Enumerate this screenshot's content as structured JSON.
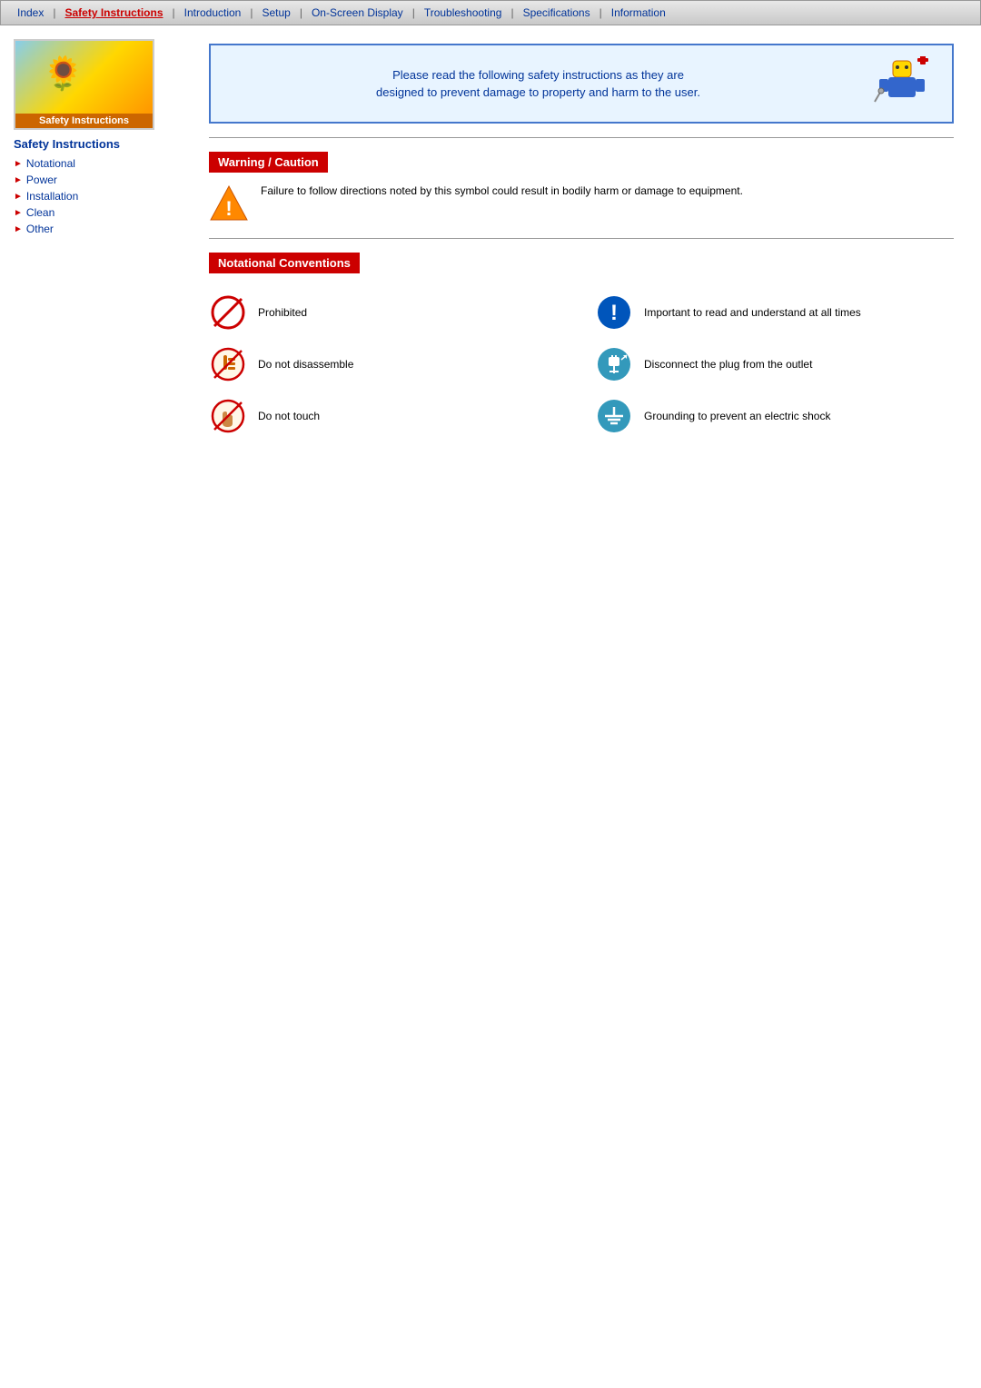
{
  "navbar": {
    "items": [
      {
        "label": "Index",
        "active": false
      },
      {
        "label": "Safety Instructions",
        "active": true
      },
      {
        "label": "Introduction",
        "active": false
      },
      {
        "label": "Setup",
        "active": false
      },
      {
        "label": "On-Screen Display",
        "active": false
      },
      {
        "label": "Troubleshooting",
        "active": false
      },
      {
        "label": "Specifications",
        "active": false
      },
      {
        "label": "Information",
        "active": false
      }
    ]
  },
  "sidebar": {
    "logo_label": "Safety Instructions",
    "section_title": "Safety Instructions",
    "links": [
      {
        "label": "Notational"
      },
      {
        "label": "Power"
      },
      {
        "label": "Installation"
      },
      {
        "label": "Clean"
      },
      {
        "label": "Other"
      }
    ]
  },
  "header": {
    "text_line1": "Please read the following safety instructions as they are",
    "text_line2": "designed to prevent damage to property and harm to the user."
  },
  "warning_section": {
    "title": "Warning / Caution",
    "description": "Failure to follow directions noted by this symbol could result in bodily harm or damage to equipment."
  },
  "notational_section": {
    "title": "Notational Conventions",
    "items": [
      {
        "icon_type": "prohibited",
        "label": "Prohibited",
        "col": 1
      },
      {
        "icon_type": "important",
        "label": "Important to read and understand at all times",
        "col": 2
      },
      {
        "icon_type": "disassemble",
        "label": "Do not disassemble",
        "col": 1
      },
      {
        "icon_type": "disconnect",
        "label": "Disconnect the plug from the outlet",
        "col": 2
      },
      {
        "icon_type": "touch",
        "label": "Do not touch",
        "col": 1
      },
      {
        "icon_type": "grounding",
        "label": "Grounding to prevent an electric shock",
        "col": 2
      }
    ]
  }
}
